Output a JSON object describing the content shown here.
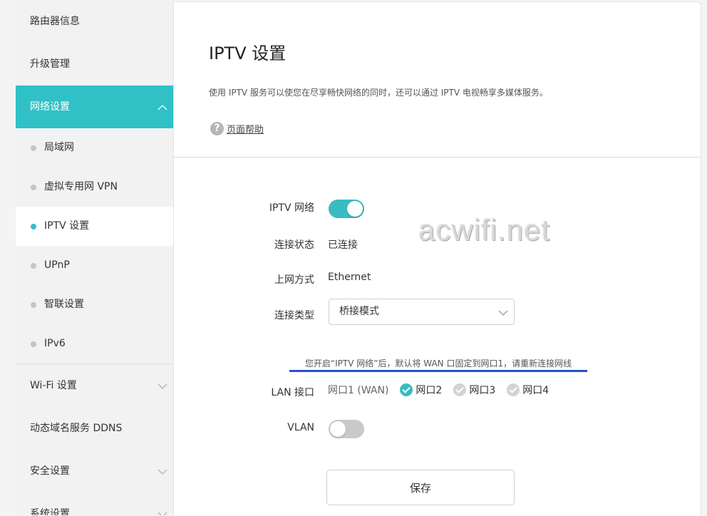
{
  "sidebar": {
    "top_items": [
      {
        "label": "路由器信息"
      },
      {
        "label": "升级管理"
      },
      {
        "label": "网络设置"
      }
    ],
    "sub_items": [
      {
        "label": "局域网"
      },
      {
        "label": "虚拟专用网 VPN"
      },
      {
        "label": "IPTV 设置"
      },
      {
        "label": "UPnP"
      },
      {
        "label": "智联设置"
      },
      {
        "label": "IPv6"
      }
    ],
    "bottom_items": [
      {
        "label": "Wi-Fi 设置"
      },
      {
        "label": "动态域名服务 DDNS"
      },
      {
        "label": "安全设置"
      },
      {
        "label": "系统设置"
      }
    ]
  },
  "page": {
    "title": "IPTV 设置",
    "description": "使用 IPTV 服务可以使您在尽享畅快网络的同时，还可以通过 IPTV 电视畅享多媒体服务。",
    "help_icon": "?",
    "help_link": "页面帮助"
  },
  "form": {
    "iptv_label": "IPTV 网络",
    "status_label": "连接状态",
    "status_value": "已连接",
    "method_label": "上网方式",
    "method_value": "Ethernet",
    "type_label": "连接类型",
    "type_value": "桥接模式",
    "notice": "您开启“IPTV 网络”后，默认将 WAN 口固定到网口1，请重新连接网线",
    "lan_label": "LAN 接口",
    "port_fixed": "网口1 (WAN)",
    "ports": [
      {
        "label": "网口2"
      },
      {
        "label": "网口3"
      },
      {
        "label": "网口4"
      }
    ],
    "vlan_label": "VLAN",
    "save_label": "保存"
  },
  "watermark": "acwifi.net",
  "colors": {
    "accent": "#2fc1c6",
    "notice_underline": "#2553c8"
  },
  "icons": {
    "chevron_up": "chevron-up-icon",
    "chevron_down": "chevron-down-icon",
    "help": "question-circle-icon",
    "check": "check-circle-icon"
  }
}
